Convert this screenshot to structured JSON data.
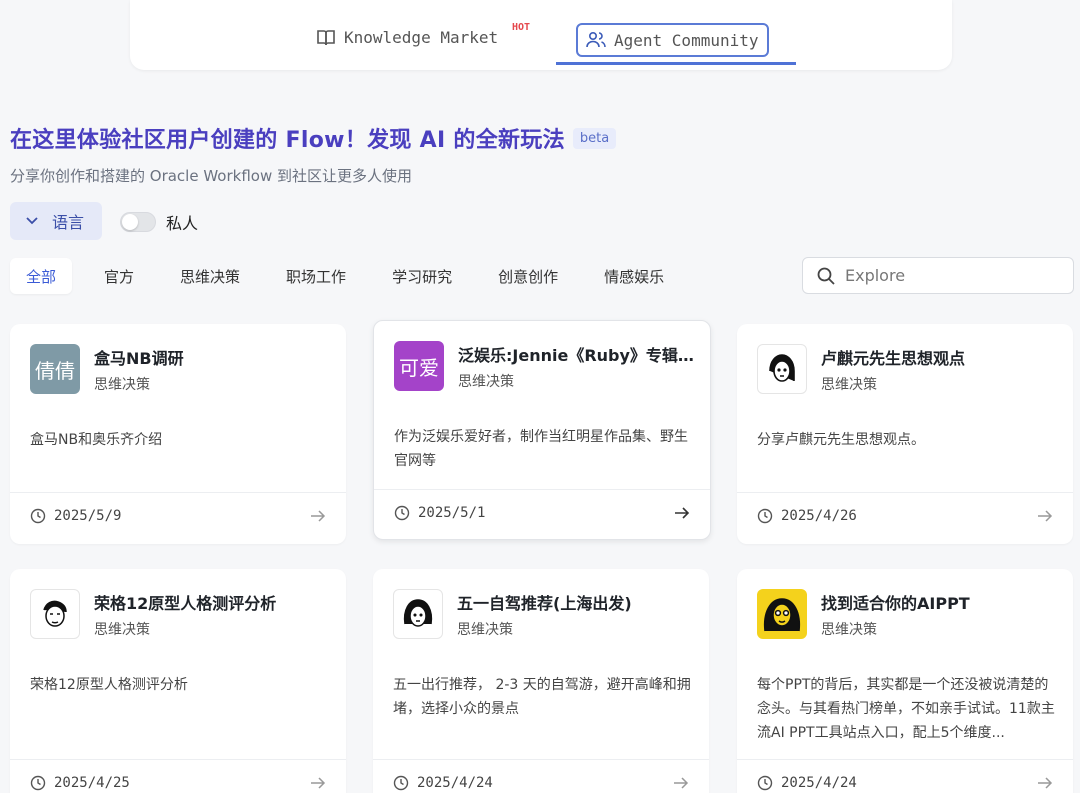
{
  "nav": {
    "tab_knowledge": "Knowledge Market",
    "hot_badge": "HOT",
    "tab_agent": "Agent Community"
  },
  "header": {
    "title": "在这里体验社区用户创建的 Flow！发现 AI 的全新玩法",
    "beta": "beta",
    "subtitle": "分享你创作和搭建的 Oracle Workflow 到社区让更多人使用"
  },
  "filters": {
    "language_label": "语言",
    "private_label": "私人",
    "private_on": false
  },
  "categories": [
    "全部",
    "官方",
    "思维决策",
    "职场工作",
    "学习研究",
    "创意创作",
    "情感娱乐"
  ],
  "search": {
    "placeholder": "Explore"
  },
  "cards": [
    {
      "avatar_text": "倩倩",
      "avatar_color": "#7f9aa6",
      "title": "盒马NB调研",
      "category": "思维决策",
      "desc": "盒马NB和奥乐齐介绍",
      "date": "2025/5/9"
    },
    {
      "avatar_text": "可爱",
      "avatar_color": "#a443c9",
      "title": "泛娱乐:Jennie《Ruby》专辑...",
      "category": "思维决策",
      "desc": "作为泛娱乐爱好者，制作当红明星作品集、野生官网等",
      "date": "2025/5/1"
    },
    {
      "avatar_text": "",
      "avatar_color": "#ffffff",
      "title": "卢麒元先生思想观点",
      "category": "思维决策",
      "desc": "分享卢麒元先生思想观点。",
      "date": "2025/4/26"
    },
    {
      "avatar_text": "",
      "avatar_color": "#ffffff",
      "title": "荣格12原型人格测评分析",
      "category": "思维决策",
      "desc": "荣格12原型人格测评分析",
      "date": "2025/4/25"
    },
    {
      "avatar_text": "",
      "avatar_color": "#ffffff",
      "title": "五一自驾推荐(上海出发)",
      "category": "思维决策",
      "desc": "五一出行推荐， 2-3 天的自驾游，避开高峰和拥堵，选择小众的景点",
      "date": "2025/4/24"
    },
    {
      "avatar_text": "",
      "avatar_color": "#f4d21c",
      "title": "找到适合你的AIPPT",
      "category": "思维决策",
      "desc": "每个PPT的背后，其实都是一个还没被说清楚的念头。与其看热门榜单，不如亲手试试。11款主流AI PPT工具站点入口，配上5个维度...",
      "date": "2025/4/24"
    }
  ]
}
